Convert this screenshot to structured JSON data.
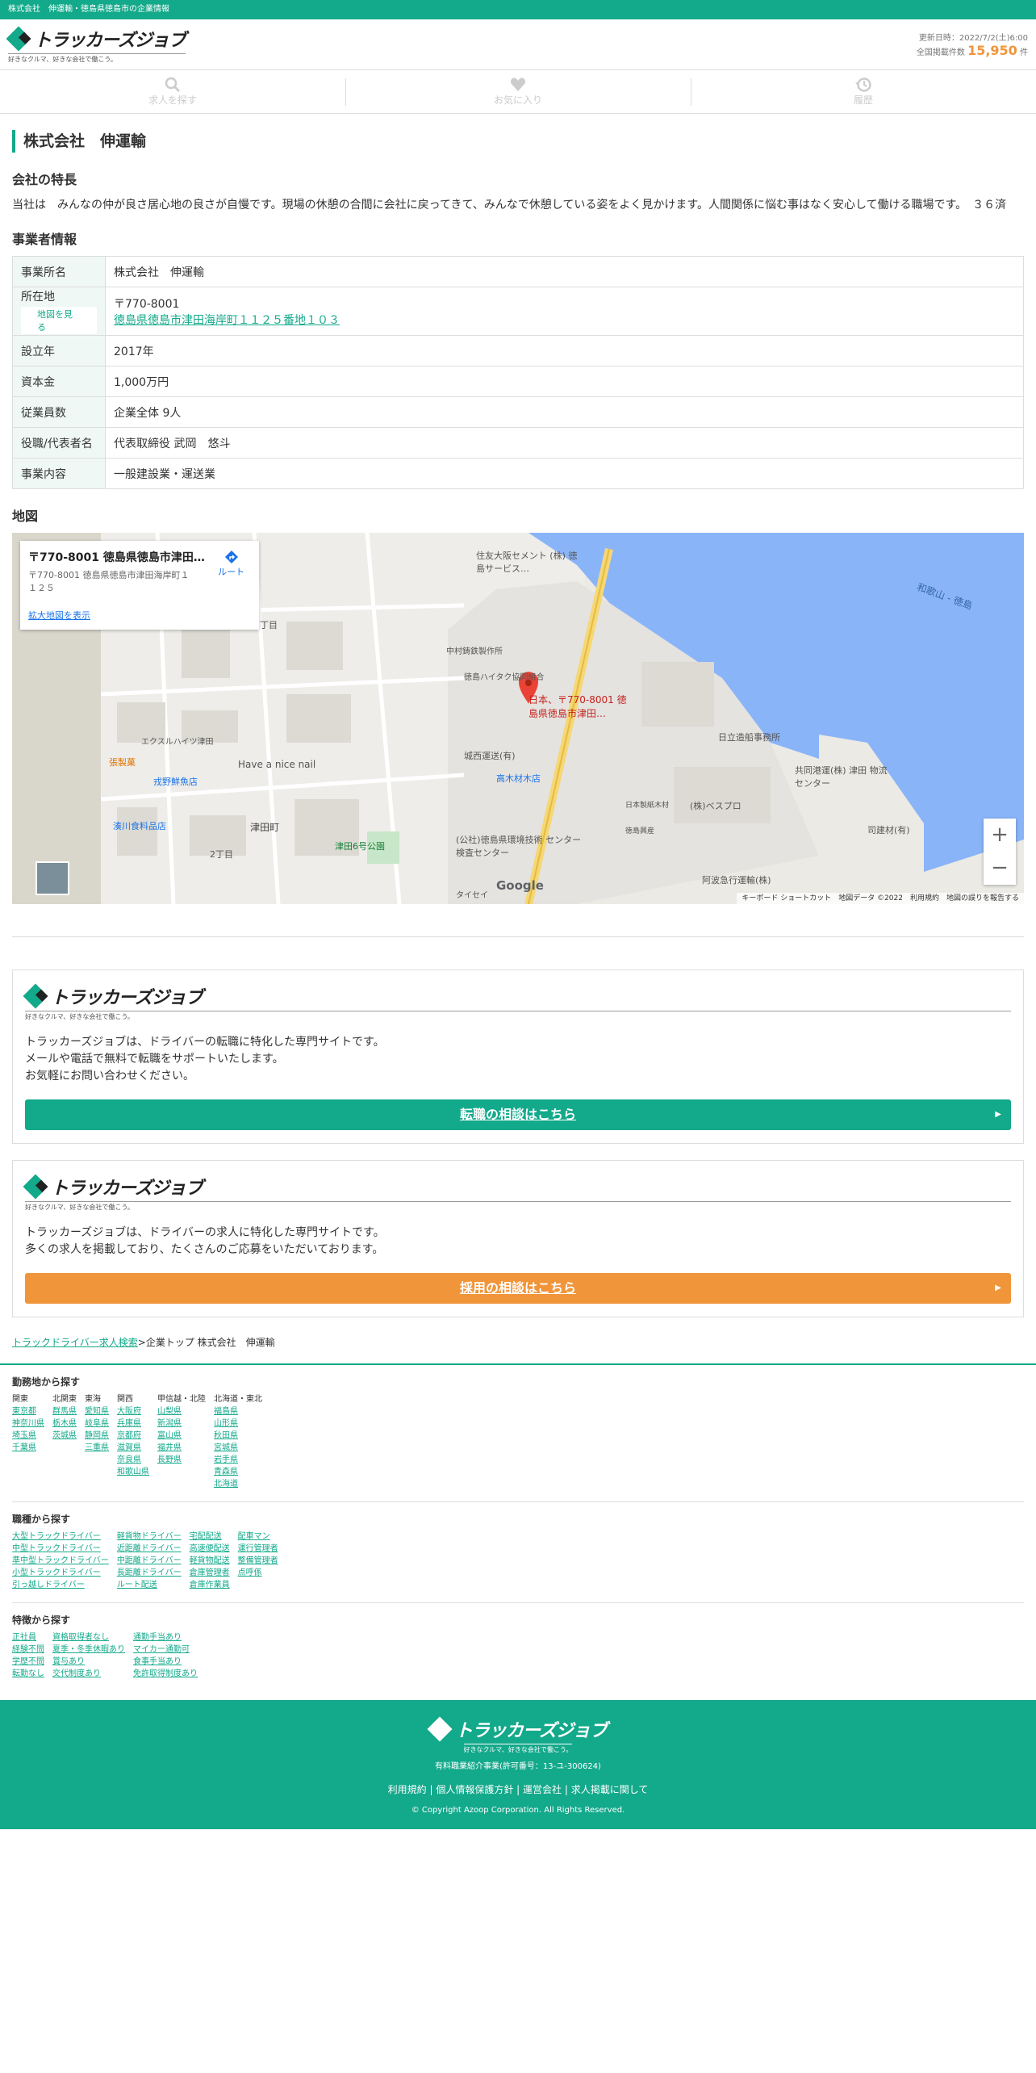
{
  "topbar": {
    "text": "株式会社　伸運輸・徳島県徳島市の企業情報"
  },
  "header": {
    "logo_text": "トラッカーズジョブ",
    "logo_sub": "好きなクルマ、好きな会社で働こう。",
    "updated": "更新日時：2022/7/2(土)6:00",
    "listings_label": "全国掲載件数",
    "listings_count": "15,950",
    "listings_unit": "件"
  },
  "nav": [
    {
      "label": "求人を探す",
      "icon": "search-icon"
    },
    {
      "label": "お気に入り",
      "icon": "heart-icon"
    },
    {
      "label": "履歴",
      "icon": "history-icon"
    }
  ],
  "company": {
    "name": "株式会社　伸運輸",
    "feature_heading": "会社の特長",
    "feature_text": "当社は　みんなの仲が良さ居心地の良さが自慢です。現場の休憩の合間に会社に戻ってきて、みんなで休憩している姿をよく見かけます。人間関係に悩む事はなく安心して働ける職場です。　３６済",
    "biz_heading": "事業者情報",
    "rows": [
      {
        "key": "事業所名",
        "value": "株式会社　伸運輸"
      },
      {
        "key": "所在地",
        "map_button": "地図を見る",
        "postal": "〒770-8001",
        "address": "徳島県徳島市津田海岸町１１２５番地１０３"
      },
      {
        "key": "設立年",
        "value": "2017年"
      },
      {
        "key": "資本金",
        "value": "1,000万円"
      },
      {
        "key": "従業員数",
        "value": "企業全体 9人"
      },
      {
        "key": "役職/代表者名",
        "value": "代表取締役 武岡　悠斗"
      },
      {
        "key": "事業内容",
        "value": "一般建設業・運送業"
      }
    ]
  },
  "map": {
    "heading": "地図",
    "card_title": "〒770-8001 徳島県徳島市津田…",
    "card_address": "〒770-8001 徳島県徳島市津田海岸町１１２５",
    "route": "ルート",
    "enlarge": "拡大地図を表示",
    "marker_label": "日本、〒770-8001 徳島県徳島市津田…",
    "places": [
      "住友大阪セメント (株) 徳島サービス…",
      "中村鋳鉄製作所",
      "徳島ハイタク協同組合",
      "城西運送(有)",
      "高木材木店",
      "日立造船事務所",
      "共同港運(株) 津田 物流センター",
      "(株)ベスプロ",
      "日本製紙木材",
      "司建材(有)",
      "徳島興産",
      "(公社)徳島県環境技術 センター 検査センター",
      "阿波急行運輸(株)",
      "エクスルハイツ津田",
      "張製菓",
      "戎野鮮魚店",
      "湊川食料品店",
      "Have a nice nail",
      "津田町",
      "2丁目",
      "1丁目",
      "津田6号公園",
      "和歌山 - 徳島",
      "タイセイ"
    ],
    "footer": "キーボード ショートカット　地図データ ©2022　利用規約　地図の誤りを報告する",
    "google": "Google"
  },
  "promos": [
    {
      "text": [
        "トラッカーズジョブは、ドライバーの転職に特化した専門サイトです。",
        "メールや電話で無料で転職をサポートいたします。",
        "お気軽にお問い合わせください。"
      ],
      "cta": "転職の相談はこちら"
    },
    {
      "text": [
        "トラッカーズジョブは、ドライバーの求人に特化した専門サイトです。",
        "多くの求人を掲載しており、たくさんのご応募をいただいております。"
      ],
      "cta": "採用の相談はこちら"
    }
  ],
  "breadcrumb": {
    "link": "トラックドライバー求人検索",
    "rest": ">企業トップ 株式会社　伸運輸"
  },
  "search_areas": {
    "heading": "勤務地から探す",
    "cols": [
      {
        "hd": "関東",
        "items": [
          "東京都",
          "神奈川県",
          "埼玉県",
          "千葉県"
        ]
      },
      {
        "hd": "北関東",
        "items": [
          "群馬県",
          "栃木県",
          "茨城県"
        ]
      },
      {
        "hd": "東海",
        "items": [
          "愛知県",
          "岐阜県",
          "静岡県",
          "三重県"
        ]
      },
      {
        "hd": "関西",
        "items": [
          "大阪府",
          "兵庫県",
          "京都府",
          "滋賀県",
          "奈良県",
          "和歌山県"
        ]
      },
      {
        "hd": "甲信越・北陸",
        "items": [
          "山梨県",
          "新潟県",
          "富山県",
          "福井県",
          "長野県"
        ]
      },
      {
        "hd": "北海道・東北",
        "items": [
          "福島県",
          "山形県",
          "秋田県",
          "宮城県",
          "岩手県",
          "青森県",
          "北海道"
        ]
      }
    ]
  },
  "search_jobs": {
    "heading": "職種から探す",
    "cols": [
      {
        "items": [
          "大型トラックドライバー",
          "中型トラックドライバー",
          "準中型トラックドライバー",
          "小型トラックドライバー",
          "引っ越しドライバー"
        ]
      },
      {
        "items": [
          "軽貨物ドライバー",
          "近距離ドライバー",
          "中距離ドライバー",
          "長距離ドライバー",
          "ルート配送"
        ]
      },
      {
        "items": [
          "宅配配送",
          "高速便配送",
          "軽貨物配送",
          "倉庫管理者",
          "倉庫作業員"
        ]
      },
      {
        "items": [
          "配車マン",
          "運行管理者",
          "整備管理者",
          "点呼係"
        ]
      }
    ]
  },
  "search_features": {
    "heading": "特徴から探す",
    "cols": [
      {
        "items": [
          "正社員",
          "経験不問",
          "学歴不問",
          "転勤なし"
        ]
      },
      {
        "items": [
          "資格取得者なし",
          "夏季・冬季休暇あり",
          "賞与あり",
          "交代制度あり"
        ]
      },
      {
        "items": [
          "通勤手当あり",
          "マイカー通勤可",
          "食事手当あり",
          "免許取得制度あり"
        ]
      }
    ]
  },
  "footer": {
    "logo_text": "トラッカーズジョブ",
    "logo_sub": "好きなクルマ、好きな会社で働こう。",
    "license": "有料職業紹介事業(許可番号：13-ユ-300624)",
    "links": [
      "利用規約",
      "個人情報保護方針",
      "運営会社",
      "求人掲載に関して"
    ],
    "copyright": "© Copyright Azoop Corporation. All Rights Reserved."
  },
  "colors": {
    "brand": "#13a98b",
    "accent": "#f0953a",
    "water": "#8ab4f8"
  }
}
